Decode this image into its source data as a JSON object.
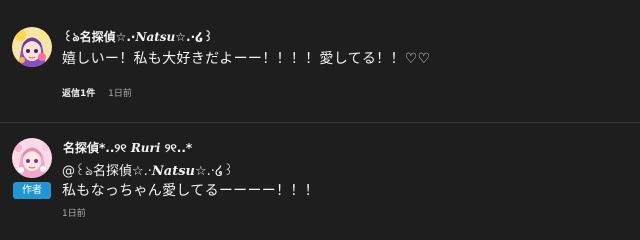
{
  "colors": {
    "background": "#1e1e1e",
    "divider": "#3a3a3a",
    "author_badge_bg": "#2196d3",
    "meta_text": "#aaaaaa"
  },
  "comments": [
    {
      "author_prefix": "꒰ঌ名探偵☆.·",
      "author_italic": "Natsu",
      "author_suffix": "☆.·໒꒱",
      "text": "嬉しいー！私も大好きだよーー！！！！愛してる！！♡♡",
      "reply_count": "返信1件",
      "timestamp": "1日前",
      "avatar_icon": "anime-avatar-yellow"
    },
    {
      "author_prefix": "名探偵*..୨୧ ",
      "author_italic": "Ruri",
      "author_suffix": " ୨୧..*",
      "mention_prefix": "@꒰ঌ名探偵☆.·",
      "mention_italic": "Natsu",
      "mention_suffix": "☆.·໒꒱",
      "text": "私もなっちゃん愛してるーーーー！！！",
      "badge": "作者",
      "timestamp": "1日前",
      "avatar_icon": "anime-avatar-pink"
    }
  ]
}
